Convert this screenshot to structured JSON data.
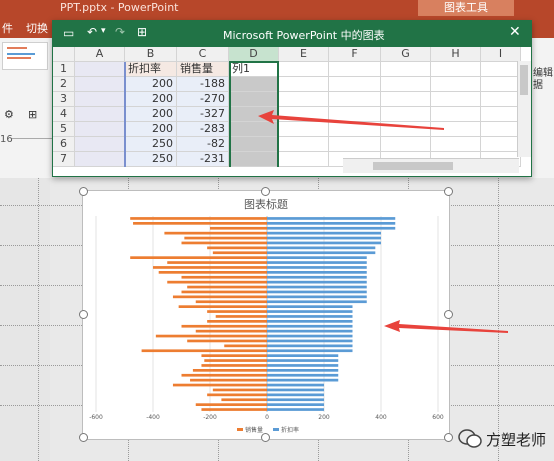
{
  "powerpoint": {
    "title": "PPT.pptx - PowerPoint",
    "chart_tools": "图表工具",
    "tabs": [
      "件",
      "切换"
    ],
    "ribbon_edit": "编辑",
    "ribbon_edit2": "据",
    "ruler_start": "16"
  },
  "excel": {
    "title": "Microsoft PowerPoint 中的图表",
    "columns": [
      "A",
      "B",
      "C",
      "D",
      "E",
      "F",
      "G",
      "H",
      "I"
    ],
    "rows": [
      {
        "n": "1",
        "b": "折扣率",
        "c": "销售量",
        "d": "列1"
      },
      {
        "n": "2",
        "b": "200",
        "c": "-188",
        "d": ""
      },
      {
        "n": "3",
        "b": "200",
        "c": "-270",
        "d": ""
      },
      {
        "n": "4",
        "b": "200",
        "c": "-327",
        "d": ""
      },
      {
        "n": "5",
        "b": "200",
        "c": "-283",
        "d": ""
      },
      {
        "n": "6",
        "b": "250",
        "c": "-82",
        "d": ""
      },
      {
        "n": "7",
        "b": "250",
        "c": "-231",
        "d": ""
      }
    ]
  },
  "watermark": "方塑老师",
  "colors": {
    "ppt_red": "#b7472a",
    "excel_green": "#217346",
    "orange": "#ed7d31",
    "blue": "#5b9bd5",
    "arrow": "#e8433c"
  },
  "chart_data": {
    "type": "bar",
    "orientation": "horizontal",
    "title": "图表标题",
    "xlim": [
      -600,
      600
    ],
    "xticks": [
      "-600",
      "-400",
      "-200",
      "0",
      "200",
      "400",
      "600"
    ],
    "legend_position": "bottom",
    "series": [
      {
        "name": "销售量",
        "color": "#ed7d31",
        "values": [
          -480,
          -470,
          -200,
          -360,
          -290,
          -300,
          -210,
          -190,
          -480,
          -350,
          -400,
          -380,
          -300,
          -350,
          -280,
          -300,
          -330,
          -250,
          -310,
          -210,
          -180,
          -210,
          -300,
          -250,
          -390,
          -280,
          -150,
          -440,
          -230,
          -220,
          -230,
          -260,
          -300,
          -270,
          -330,
          -190,
          -210,
          -160,
          -250,
          -230
        ]
      },
      {
        "name": "折扣率",
        "color": "#5b9bd5",
        "values": [
          450,
          450,
          450,
          400,
          400,
          400,
          380,
          380,
          350,
          350,
          350,
          350,
          350,
          350,
          350,
          350,
          350,
          350,
          300,
          300,
          300,
          300,
          300,
          300,
          300,
          300,
          300,
          300,
          250,
          250,
          250,
          250,
          250,
          250,
          200,
          200,
          200,
          200,
          200,
          200
        ]
      }
    ]
  }
}
